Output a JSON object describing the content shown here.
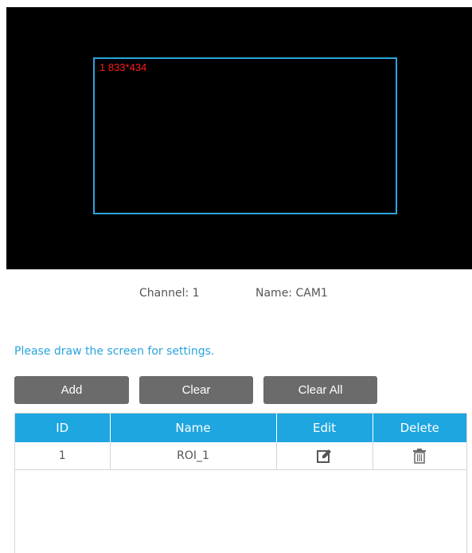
{
  "preview": {
    "roi_label": "1 833*434",
    "roi_color": "#ff1a1a",
    "roi_border_color": "#2aa4dd"
  },
  "info": {
    "channel": "Channel: 1",
    "name": "Name: CAM1"
  },
  "instruction": "Please draw the screen for settings.",
  "buttons": {
    "add": "Add",
    "clear": "Clear",
    "clear_all": "Clear All"
  },
  "table": {
    "headers": {
      "id": "ID",
      "name": "Name",
      "edit": "Edit",
      "delete": "Delete"
    },
    "rows": [
      {
        "id": "1",
        "name": "ROI_1",
        "edit_icon": "edit-icon",
        "delete_icon": "trash-icon"
      }
    ]
  },
  "colors": {
    "accent": "#1ea6e0",
    "button_bg": "#6b6b6b"
  }
}
